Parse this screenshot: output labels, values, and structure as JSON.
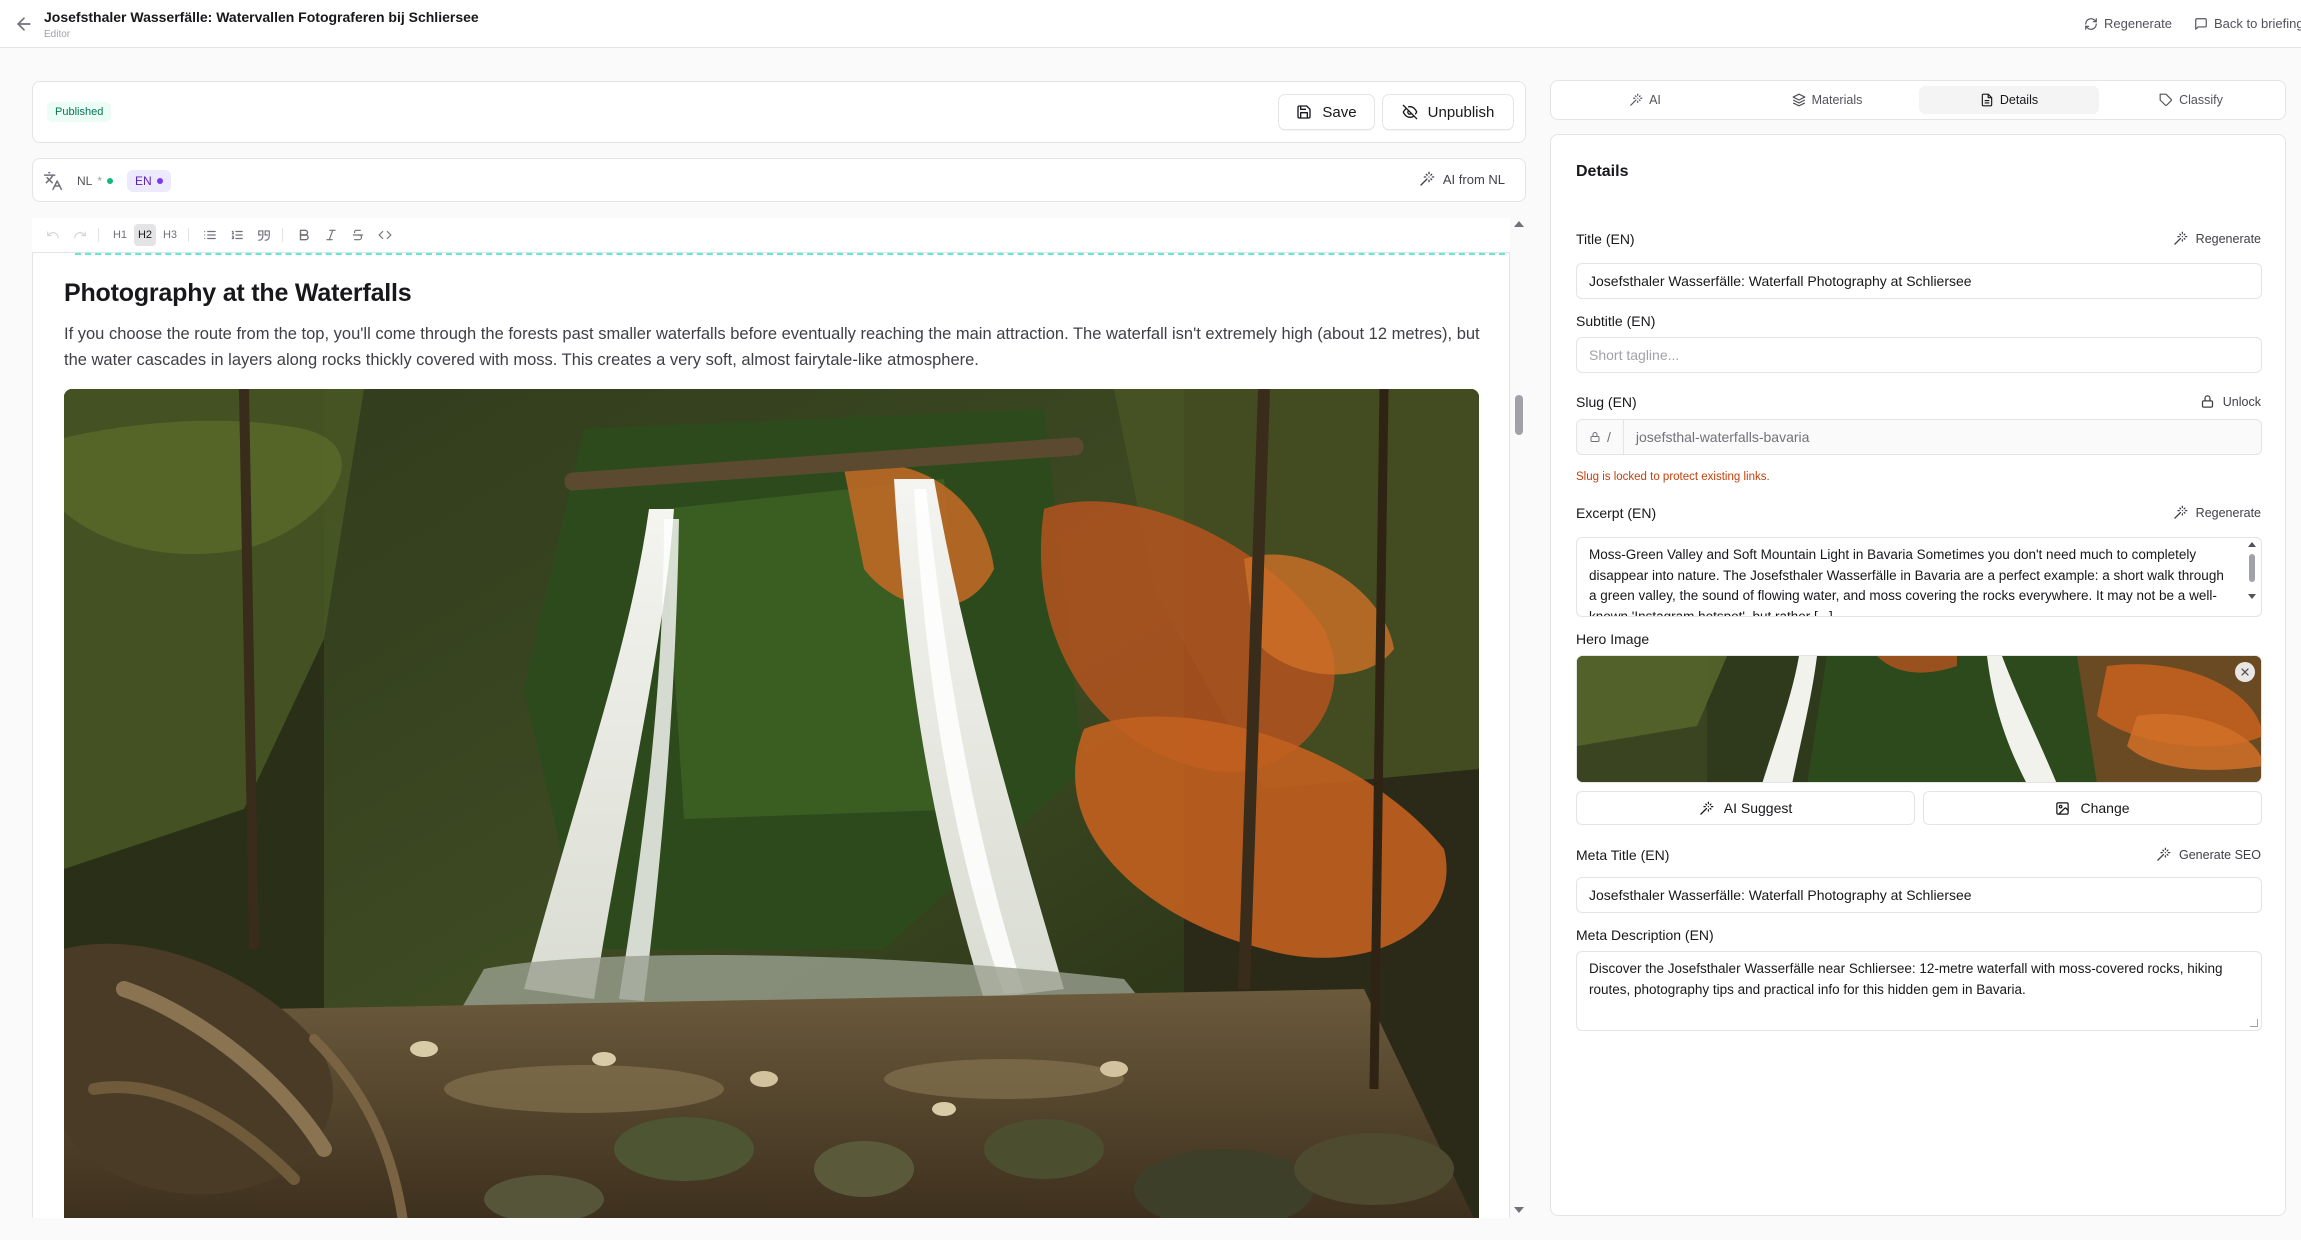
{
  "header": {
    "title": "Josefsthaler Wasserfälle: Watervallen Fotograferen bij Schliersee",
    "subtitle": "Editor",
    "regenerate_label": "Regenerate",
    "back_label": "Back to briefing"
  },
  "status": {
    "badge": "Published",
    "save_label": "Save",
    "unpublish_label": "Unpublish"
  },
  "languages": {
    "tabs": [
      {
        "label": "NL",
        "marker": "*",
        "dot_color": "#10b981"
      },
      {
        "label": "EN",
        "dot_color": "#7c3aed"
      }
    ],
    "ai_from_label": "AI from NL"
  },
  "toolbar": {
    "h1": "H1",
    "h2": "H2",
    "h3": "H3"
  },
  "editor": {
    "heading": "Photography at the Waterfalls",
    "paragraph": "If you choose the route from the top, you'll come through the forests past smaller waterfalls before eventually reaching the main attraction. The waterfall isn't extremely high (about 12 metres), but the water cascades in layers along rocks thickly covered with moss. This creates a very soft, almost fairytale-like atmosphere."
  },
  "side_tabs": [
    {
      "label": "AI"
    },
    {
      "label": "Materials"
    },
    {
      "label": "Details"
    },
    {
      "label": "Classify"
    }
  ],
  "details": {
    "title": "Details",
    "title_label": "Title (EN)",
    "title_action": "Regenerate",
    "title_value": "Josefsthaler Wasserfälle: Waterfall Photography at Schliersee",
    "subtitle_label": "Subtitle (EN)",
    "subtitle_placeholder": "Short tagline...",
    "slug_label": "Slug (EN)",
    "slug_action": "Unlock",
    "slug_prefix": "/",
    "slug_value": "josefsthal-waterfalls-bavaria",
    "slug_helper": "Slug is locked to protect existing links.",
    "excerpt_label": "Excerpt (EN)",
    "excerpt_action": "Regenerate",
    "excerpt_value": "Moss-Green Valley and Soft Mountain Light in Bavaria Sometimes you don't need much to completely disappear into nature. The Josefsthaler Wasserfälle in Bavaria are a perfect example: a short walk through a green valley, the sound of flowing water, and moss covering the rocks everywhere. It may not be a well-known 'Instagram hotspot', but rather [...]",
    "hero_label": "Hero Image",
    "ai_suggest_label": "AI Suggest",
    "change_label": "Change",
    "meta_title_label": "Meta Title (EN)",
    "meta_title_action": "Generate SEO",
    "meta_title_value": "Josefsthaler Wasserfälle: Waterfall Photography at Schliersee",
    "meta_desc_label": "Meta Description (EN)",
    "meta_desc_value": "Discover the Josefsthaler Wasserfälle near Schliersee: 12-metre waterfall with moss-covered rocks, hiking routes, photography tips and practical info for this hidden gem in Bavaria."
  },
  "icons": {
    "back": "arrow-left-icon",
    "regenerate": "refresh-icon",
    "back_briefing": "message-square-icon",
    "save": "save-icon",
    "unpublish": "eye-off-icon",
    "translate": "languages-icon",
    "ai": "wand-icon",
    "lock": "lock-icon",
    "close": "x-icon",
    "image": "image-icon"
  },
  "colors": {
    "accent": "#7c3aed",
    "published_bg": "#ecfdf5",
    "published_text": "#047857",
    "helper_warning": "#c2410c",
    "border": "#e4e4e7"
  }
}
